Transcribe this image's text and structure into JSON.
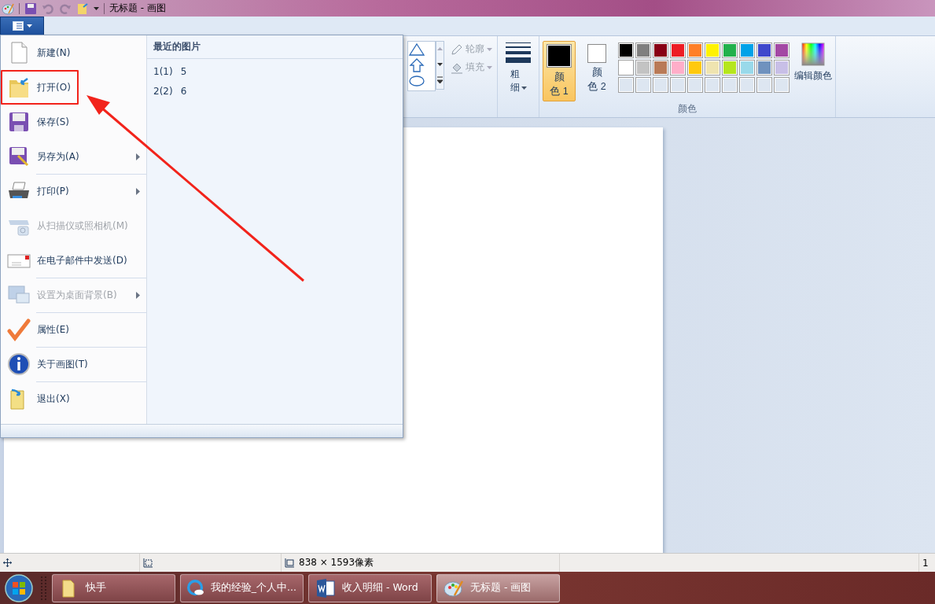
{
  "window": {
    "title": "无标题 - 画图"
  },
  "app_menu": {
    "open": true,
    "items": [
      {
        "kind": "new",
        "label": "新建(N)",
        "submenu": false,
        "disabled": false,
        "divider_before": false,
        "annotated": false
      },
      {
        "kind": "open",
        "label": "打开(O)",
        "submenu": false,
        "disabled": false,
        "divider_before": false,
        "annotated": true
      },
      {
        "kind": "save",
        "label": "保存(S)",
        "submenu": false,
        "disabled": false,
        "divider_before": false,
        "annotated": false
      },
      {
        "kind": "saveas",
        "label": "另存为(A)",
        "submenu": true,
        "disabled": false,
        "divider_before": false,
        "annotated": false
      },
      {
        "kind": "print",
        "label": "打印(P)",
        "submenu": true,
        "disabled": false,
        "divider_before": true,
        "annotated": false
      },
      {
        "kind": "scanner",
        "label": "从扫描仪或照相机(M)",
        "submenu": false,
        "disabled": true,
        "divider_before": false,
        "annotated": false
      },
      {
        "kind": "email",
        "label": "在电子邮件中发送(D)",
        "submenu": false,
        "disabled": false,
        "divider_before": false,
        "annotated": false
      },
      {
        "kind": "desktop",
        "label": "设置为桌面背景(B)",
        "submenu": true,
        "disabled": true,
        "divider_before": true,
        "annotated": false
      },
      {
        "kind": "properties",
        "label": "属性(E)",
        "submenu": false,
        "disabled": false,
        "divider_before": true,
        "annotated": false
      },
      {
        "kind": "about",
        "label": "关于画图(T)",
        "submenu": false,
        "disabled": false,
        "divider_before": true,
        "annotated": false
      },
      {
        "kind": "exit",
        "label": "退出(X)",
        "submenu": false,
        "disabled": false,
        "divider_before": true,
        "annotated": false
      }
    ],
    "recent_title": "最近的图片",
    "recent": [
      {
        "key": "1(1)",
        "name": "5"
      },
      {
        "key": "2(2)",
        "name": "6"
      }
    ]
  },
  "ribbon": {
    "shape_tools": [
      {
        "label": "轮廓",
        "disabled": true
      },
      {
        "label": "填充",
        "disabled": true
      }
    ],
    "size_label": "粗细",
    "color_slots": [
      {
        "label": "颜色 1",
        "color": "#000000",
        "selected": true
      },
      {
        "label": "颜色 2",
        "color": "#ffffff",
        "selected": false
      }
    ],
    "palette": [
      {
        "kind": "color",
        "color": "#000000"
      },
      {
        "kind": "color",
        "color": "#7f7f7f"
      },
      {
        "kind": "color",
        "color": "#880015"
      },
      {
        "kind": "color",
        "color": "#ed1c24"
      },
      {
        "kind": "color",
        "color": "#ff7f27"
      },
      {
        "kind": "color",
        "color": "#fff200"
      },
      {
        "kind": "color",
        "color": "#22b14c"
      },
      {
        "kind": "color",
        "color": "#00a2e8"
      },
      {
        "kind": "color",
        "color": "#3f48cc"
      },
      {
        "kind": "color",
        "color": "#a349a4"
      },
      {
        "kind": "color",
        "color": "#ffffff"
      },
      {
        "kind": "color",
        "color": "#c3c3c3"
      },
      {
        "kind": "color",
        "color": "#b97a57"
      },
      {
        "kind": "color",
        "color": "#ffaec9"
      },
      {
        "kind": "color",
        "color": "#ffc90e"
      },
      {
        "kind": "color",
        "color": "#efe4b0"
      },
      {
        "kind": "color",
        "color": "#b5e61d"
      },
      {
        "kind": "color",
        "color": "#99d9ea"
      },
      {
        "kind": "color",
        "color": "#7092be"
      },
      {
        "kind": "color",
        "color": "#c8bfe7"
      },
      {
        "kind": "empty"
      },
      {
        "kind": "empty"
      },
      {
        "kind": "empty"
      },
      {
        "kind": "empty"
      },
      {
        "kind": "empty"
      },
      {
        "kind": "empty"
      },
      {
        "kind": "empty"
      },
      {
        "kind": "empty"
      },
      {
        "kind": "empty"
      },
      {
        "kind": "empty"
      }
    ],
    "edit_colors": "编辑颜色",
    "group_label": "颜色"
  },
  "status_bar": {
    "size": "838 × 1593像素",
    "zoom": "1"
  },
  "taskbar": [
    {
      "kind": "folder",
      "label": "快手",
      "selected": false
    },
    {
      "kind": "browser",
      "label": "我的经验_个人中...",
      "selected": false
    },
    {
      "kind": "word",
      "label": "收入明细 - Word",
      "selected": false
    },
    {
      "kind": "paint",
      "label": "无标题 - 画图",
      "selected": true
    }
  ]
}
